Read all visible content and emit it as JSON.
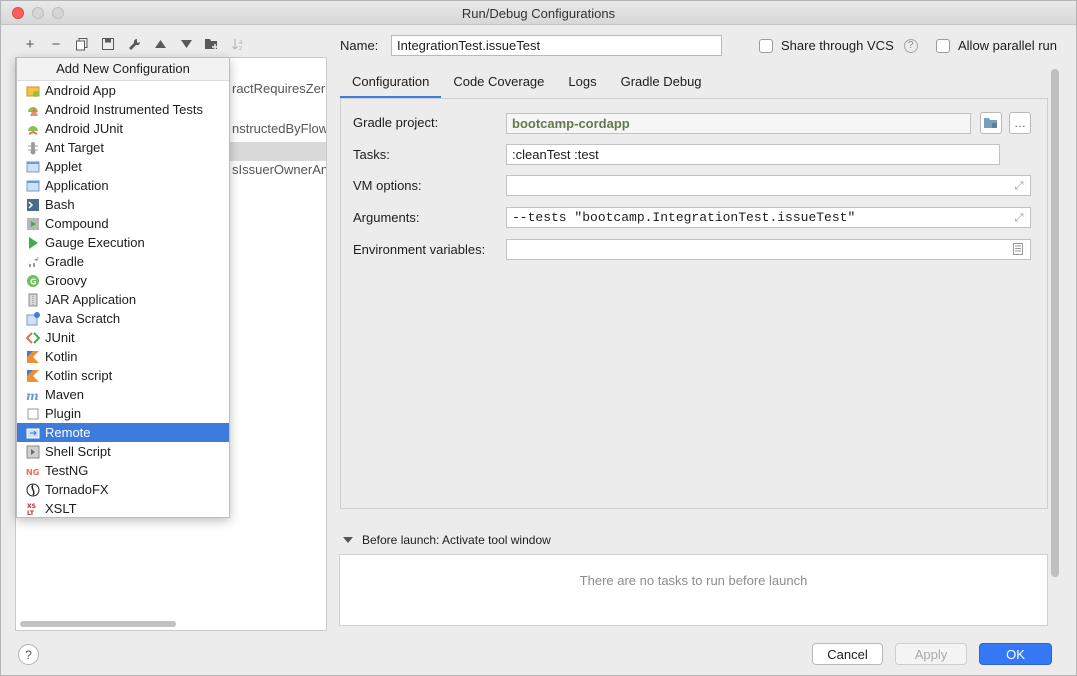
{
  "window": {
    "title": "Run/Debug Configurations"
  },
  "toolbar": {
    "buttons": [
      {
        "name": "add-icon",
        "glyph": "+"
      },
      {
        "name": "remove-icon",
        "glyph": "−"
      },
      {
        "name": "copy-icon",
        "glyph": "⧉"
      },
      {
        "name": "save-icon",
        "glyph": "▣"
      },
      {
        "name": "wrench-icon",
        "glyph": "🔧"
      },
      {
        "name": "arrow-up-icon",
        "glyph": "▲"
      },
      {
        "name": "arrow-down-icon",
        "glyph": "▼"
      },
      {
        "name": "folder-icon",
        "glyph": "▰"
      },
      {
        "name": "sort-icon",
        "glyph": "↓a"
      }
    ]
  },
  "tree_background": {
    "items": [
      "ractRequiresZer",
      "nstructedByFlow",
      "sIssuerOwnerAn"
    ]
  },
  "popup": {
    "header": "Add New Configuration",
    "items": [
      {
        "label": "Android App",
        "icon": "android-app-icon",
        "color": "#8bc34a"
      },
      {
        "label": "Android Instrumented Tests",
        "icon": "android-instrumented-icon",
        "color": "#8bc34a"
      },
      {
        "label": "Android JUnit",
        "icon": "android-junit-icon",
        "color": "#8bc34a"
      },
      {
        "label": "Ant Target",
        "icon": "ant-icon",
        "color": "#9a9a9a"
      },
      {
        "label": "Applet",
        "icon": "applet-icon",
        "color": "#6d9bd1"
      },
      {
        "label": "Application",
        "icon": "application-icon",
        "color": "#6d9bd1"
      },
      {
        "label": "Bash",
        "icon": "bash-icon",
        "color": "#4a6b8a"
      },
      {
        "label": "Compound",
        "icon": "compound-icon",
        "color": "#9a9a9a"
      },
      {
        "label": "Gauge Execution",
        "icon": "gauge-icon",
        "color": "#3fae49"
      },
      {
        "label": "Gradle",
        "icon": "gradle-icon",
        "color": "#9a9a9a"
      },
      {
        "label": "Groovy",
        "icon": "groovy-icon",
        "color": "#6fbf5a"
      },
      {
        "label": "JAR Application",
        "icon": "jar-icon",
        "color": "#8a8a8a"
      },
      {
        "label": "Java Scratch",
        "icon": "java-scratch-icon",
        "color": "#6d9bd1"
      },
      {
        "label": "JUnit",
        "icon": "junit-icon",
        "color": "#e76f51"
      },
      {
        "label": "Kotlin",
        "icon": "kotlin-icon",
        "color": "#f18e33"
      },
      {
        "label": "Kotlin script",
        "icon": "kotlin-script-icon",
        "color": "#f18e33"
      },
      {
        "label": "Maven",
        "icon": "maven-icon",
        "color": "#6d9bd1"
      },
      {
        "label": "Plugin",
        "icon": "plugin-icon",
        "color": "#9a9a9a"
      },
      {
        "label": "Remote",
        "icon": "remote-icon",
        "color": "#ffffff"
      },
      {
        "label": "Shell Script",
        "icon": "shell-script-icon",
        "color": "#8a8a8a"
      },
      {
        "label": "TestNG",
        "icon": "testng-icon",
        "color": "#e76f51"
      },
      {
        "label": "TornadoFX",
        "icon": "tornadofx-icon",
        "color": "#222222"
      },
      {
        "label": "XSLT",
        "icon": "xslt-icon",
        "color": "#c62828"
      }
    ],
    "selected": "Remote"
  },
  "name": {
    "label": "Name:",
    "value": "IntegrationTest.issueTest"
  },
  "share_vcs": {
    "label": "Share through VCS",
    "checked": false
  },
  "allow_parallel": {
    "label": "Allow parallel run",
    "checked": false
  },
  "tabs": [
    {
      "label": "Configuration",
      "active": true
    },
    {
      "label": "Code Coverage",
      "active": false
    },
    {
      "label": "Logs",
      "active": false
    },
    {
      "label": "Gradle Debug",
      "active": false
    }
  ],
  "form": {
    "gradle_project": {
      "label": "Gradle project:",
      "value": "bootcamp-cordapp"
    },
    "tasks": {
      "label": "Tasks:",
      "value": ":cleanTest :test"
    },
    "vm_options": {
      "label": "VM options:",
      "value": ""
    },
    "arguments": {
      "label": "Arguments:",
      "value": "--tests \"bootcamp.IntegrationTest.issueTest\""
    },
    "env_vars": {
      "label": "Environment variables:",
      "value": ""
    }
  },
  "before_launch": {
    "label": "Before launch: Activate tool window",
    "empty_text": "There are no tasks to run before launch"
  },
  "buttons": {
    "help": "?",
    "cancel": "Cancel",
    "apply": "Apply",
    "ok": "OK"
  },
  "colors": {
    "accent": "#3d7cdc",
    "ok_button": "#3478f6"
  }
}
